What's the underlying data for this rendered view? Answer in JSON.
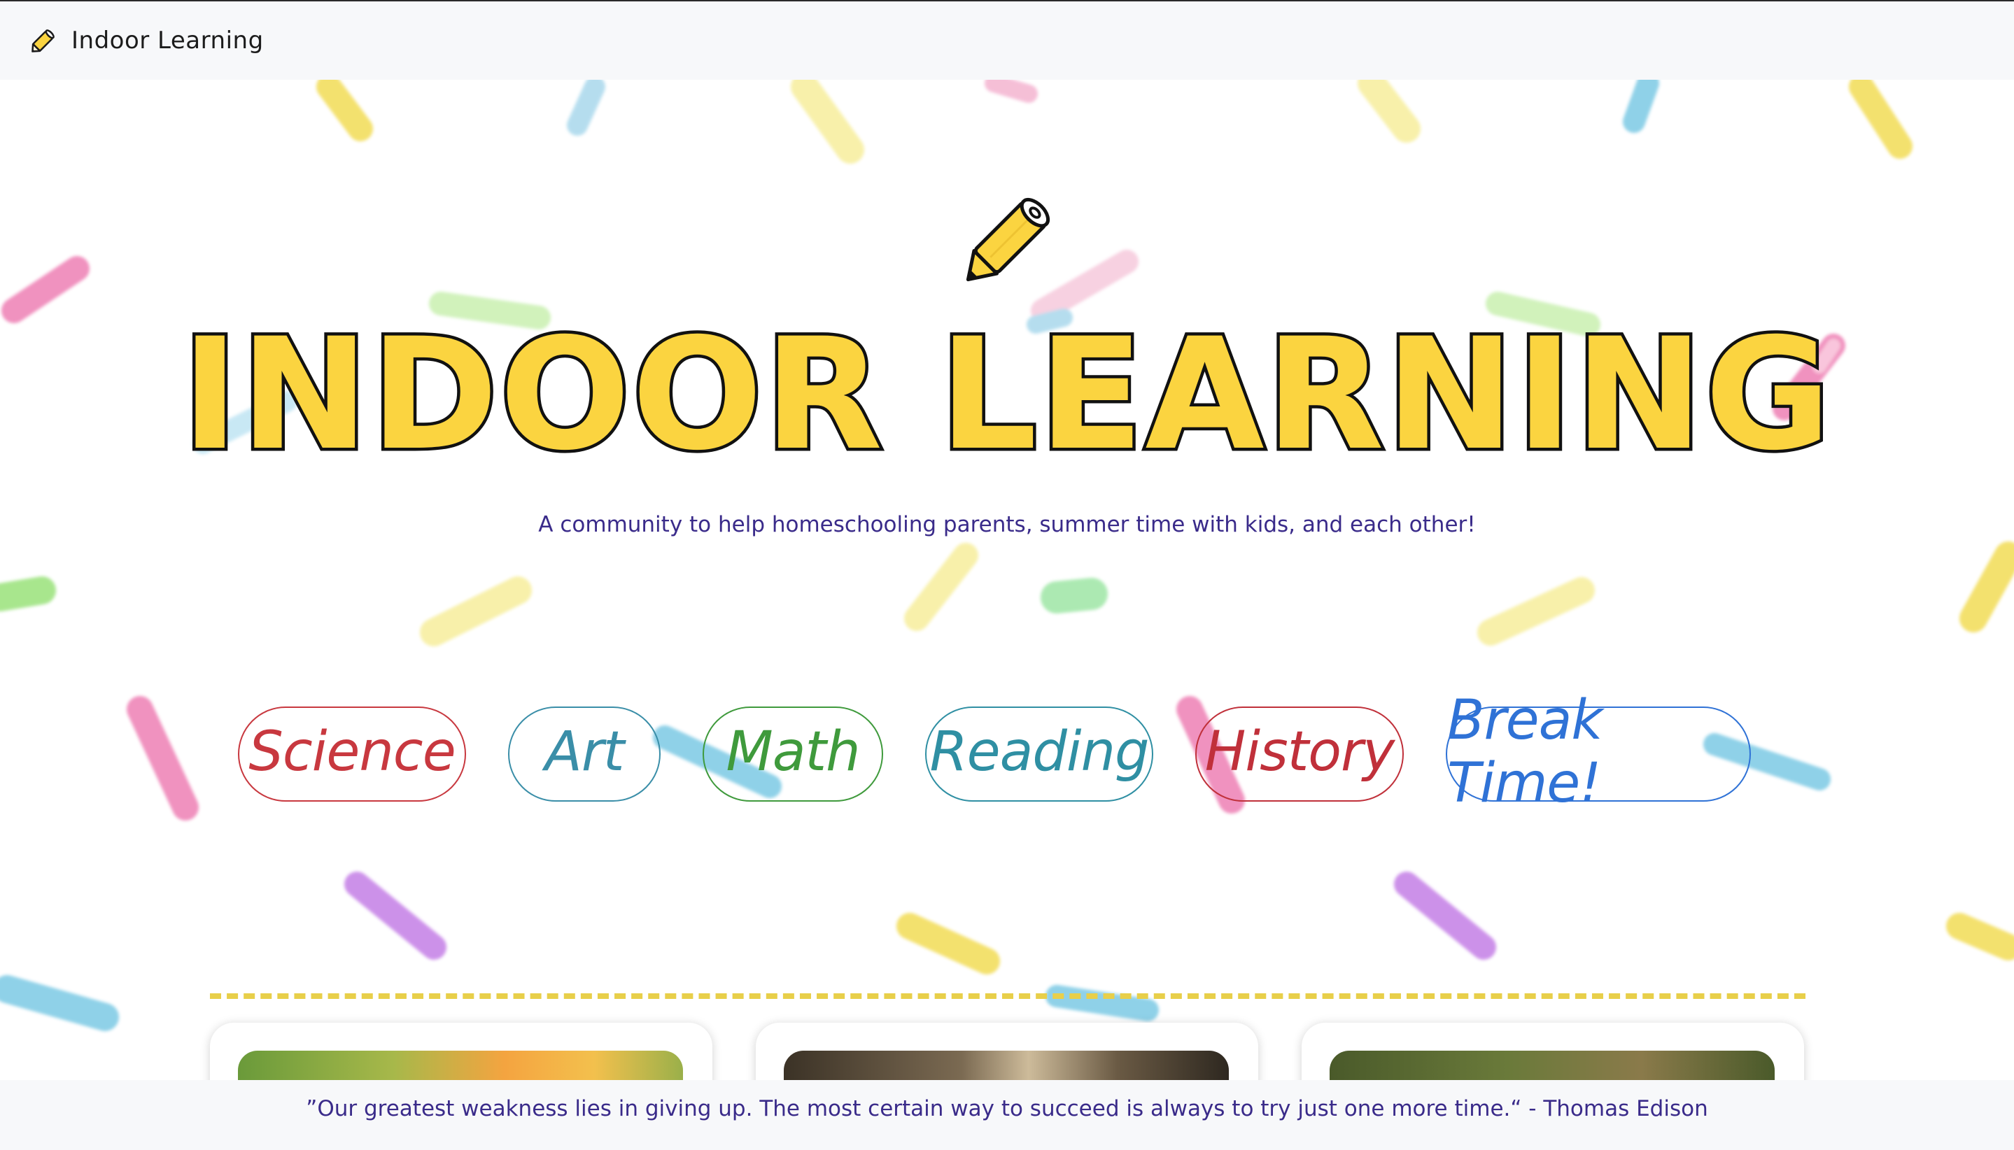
{
  "navbar": {
    "brand_text": "Indoor Learning",
    "brand_icon": "pencil-icon"
  },
  "hero": {
    "title": "INDOOR LEARNING",
    "tagline": "A community to help homeschooling parents, summer time with kids, and each other!",
    "icon": "pencil-icon"
  },
  "subjects": [
    {
      "label": "Science",
      "color": "#c8383f"
    },
    {
      "label": "Art",
      "color": "#3a8ea8"
    },
    {
      "label": "Math",
      "color": "#3f9a3c"
    },
    {
      "label": "Reading",
      "color": "#2f8fa3"
    },
    {
      "label": "History",
      "color": "#c0303a"
    },
    {
      "label": "Break Time!",
      "color": "#2f72d6"
    }
  ],
  "footer": {
    "quote": "”Our greatest weakness lies in giving up. The most certain way to succeed is always to try just one more time.“ - Thomas Edison"
  },
  "colors": {
    "title_fill": "#fbd440",
    "divider": "#e8cf4a",
    "tagline": "#3a2b8a",
    "background": "#ffffff"
  }
}
